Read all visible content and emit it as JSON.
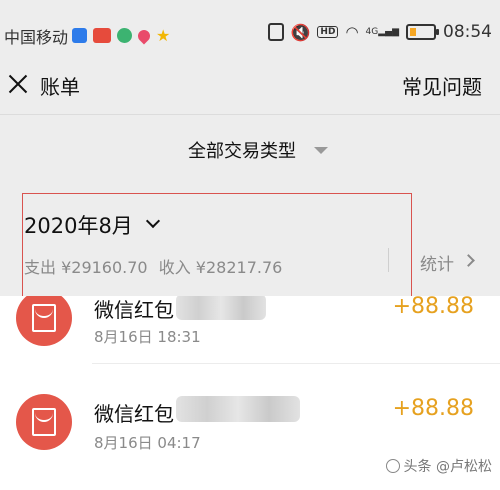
{
  "status_bar": {
    "carrier": "中国移动",
    "time": "08:54",
    "hd_label": "HD",
    "net_label": "4G"
  },
  "nav": {
    "title": "账单",
    "help": "常见问题"
  },
  "filter": {
    "label": "全部交易类型"
  },
  "summary": {
    "month": "2020年8月",
    "expense": "支出 ¥29160.70",
    "income": "收入 ¥28217.76",
    "stats_label": "统计"
  },
  "transactions": [
    {
      "title": "微信红包",
      "date": "8月16日 18:31",
      "amount": "+88.88"
    },
    {
      "title": "微信红包",
      "date": "8月16日 04:17",
      "amount": "+88.88"
    }
  ],
  "watermark": "头条 @卢松松",
  "colors": {
    "accent_amount": "#e6a11f",
    "avatar_red": "#e4574a",
    "highlight_box": "#d9534f"
  }
}
